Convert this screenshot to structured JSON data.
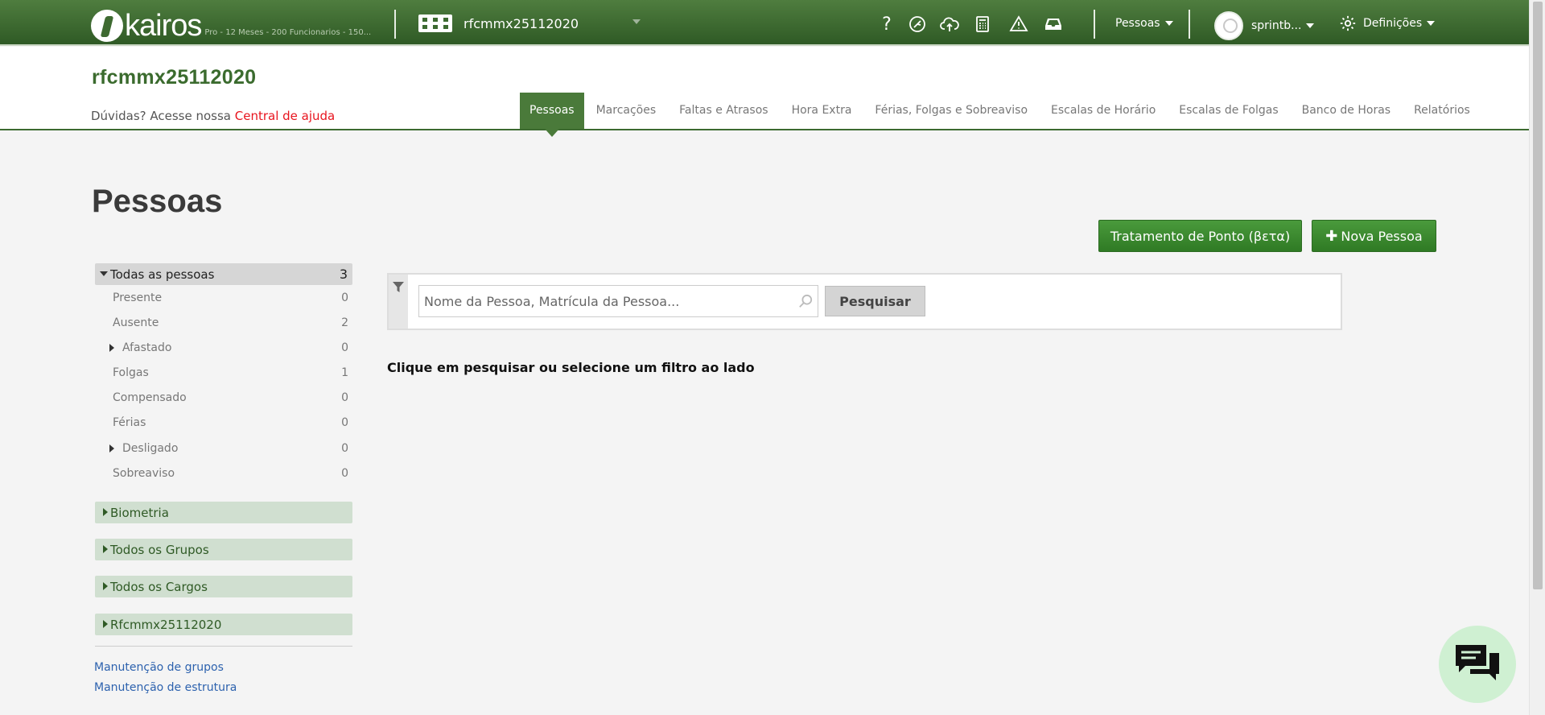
{
  "topbar": {
    "logo_text": "kairos",
    "plan_info": "Pro - 12 Meses - 200 Funcionarios - 150...",
    "company_name": "rfcmmx25112020",
    "icons": [
      "question-icon",
      "theme-icon",
      "cloud-upload-icon",
      "calculator-icon",
      "warning-icon",
      "inbox-icon"
    ],
    "nav_menu_label": "Pessoas",
    "user_name": "sprintb...",
    "settings_label": "Definições",
    "bar_color": "#3f6c33"
  },
  "header": {
    "title": "rfcmmx25112020",
    "help_text": "Dúvidas? Acesse nossa",
    "help_link": "Central de ajuda",
    "tabs": [
      {
        "label": "Pessoas",
        "active": true
      },
      {
        "label": "Marcações"
      },
      {
        "label": "Faltas e Atrasos"
      },
      {
        "label": "Hora Extra"
      },
      {
        "label": "Férias, Folgas e Sobreaviso"
      },
      {
        "label": "Escalas de Horário"
      },
      {
        "label": "Escalas de Folgas"
      },
      {
        "label": "Banco de Horas"
      },
      {
        "label": "Relatórios"
      }
    ]
  },
  "main": {
    "page_title": "Pessoas",
    "btn_tratamento": "Tratamento de Ponto (βετα)",
    "btn_nova": "Nova Pessoa",
    "search_placeholder": "Nome da Pessoa, Matrícula da Pessoa...",
    "search_button": "Pesquisar",
    "hint": "Clique em pesquisar ou selecione um filtro ao lado"
  },
  "sidebar": {
    "all_label": "Todas as pessoas",
    "all_count": "3",
    "items": [
      {
        "label": "Presente",
        "count": "0"
      },
      {
        "label": "Ausente",
        "count": "2"
      },
      {
        "label": "Afastado",
        "count": "0"
      },
      {
        "label": "Folgas",
        "count": "1"
      },
      {
        "label": "Compensado",
        "count": "0"
      },
      {
        "label": "Férias",
        "count": "0"
      },
      {
        "label": "Desligado",
        "count": "0"
      },
      {
        "label": "Sobreaviso",
        "count": "0"
      }
    ],
    "groups": [
      "Biometria",
      "Todos os Grupos",
      "Todos os Cargos",
      "Rfcmmx25112020"
    ],
    "links": [
      "Manutenção de grupos",
      "Manutenção de estrutura"
    ]
  },
  "colors": {
    "brand_green": "#3b6b2e",
    "button_green": "#3a8a2e",
    "help_link": "#e8141e",
    "link_blue": "#2d62ae"
  }
}
